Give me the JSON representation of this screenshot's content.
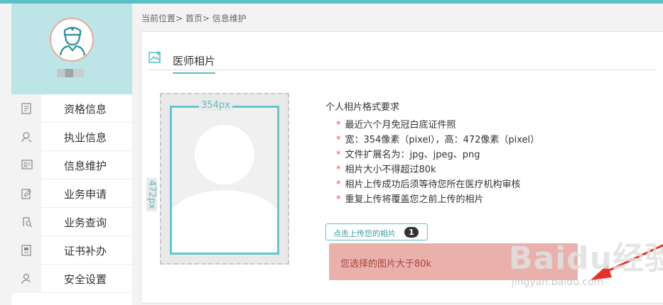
{
  "breadcrumb": "当前位置> 首页> 信息维护",
  "sidebar": {
    "items": [
      {
        "label": "资格信息",
        "icon": "document-icon"
      },
      {
        "label": "执业信息",
        "icon": "user-search-icon"
      },
      {
        "label": "信息维护",
        "icon": "id-card-icon"
      },
      {
        "label": "业务申请",
        "icon": "edit-form-icon"
      },
      {
        "label": "业务查询",
        "icon": "search-doc-icon"
      },
      {
        "label": "证书补办",
        "icon": "certificate-icon"
      },
      {
        "label": "安全设置",
        "icon": "shield-user-icon"
      }
    ]
  },
  "panel": {
    "title": "医师相片"
  },
  "photo": {
    "width_label": "354px",
    "height_label": "472px"
  },
  "requirements": {
    "title": "个人相片格式要求",
    "star": "*",
    "items": [
      "最近六个月免冠白底证件照",
      "宽：354像素（pixel），高：472像素（pixel）",
      "文件扩展名为：jpg、jpeg、png",
      "相片大小不得超过80k",
      "相片上传成功后须等待您所在医疗机构审核",
      "重复上传将覆盖您之前上传的相片"
    ]
  },
  "upload": {
    "label": "点击上传您的相片",
    "badge": "1"
  },
  "error": "您选择的图片大于80k",
  "watermark": {
    "main": "Baidu经验",
    "sub": "jingyan.baidu.com"
  },
  "colors": {
    "accent": "#5bbfc4",
    "profile_bg": "#bde5e7",
    "error_bg": "#eab1ac",
    "arrow": "#e8302a"
  }
}
